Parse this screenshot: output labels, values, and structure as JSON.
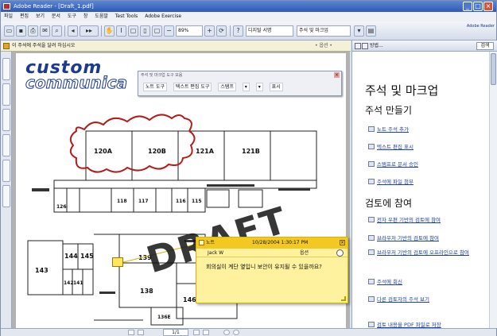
{
  "window": {
    "title": "Adobe Reader - [Draft_1.pdf]",
    "controls": [
      "_",
      "□",
      "×"
    ]
  },
  "menu": [
    "파일",
    "편집",
    "보기",
    "문서",
    "도구",
    "창",
    "도움말",
    "Test Tools",
    "Adobe Exercise"
  ],
  "toolbar": {
    "zoom": "89%",
    "select_1": "디지털 서명",
    "select_2": "주석 및 마크업",
    "logo_text": "Adobe Reader"
  },
  "docbar": {
    "text": "이 주석에 주석을 달려 하십시오",
    "right": "• 옵션 •"
  },
  "comment_toolbar": {
    "title": "주석 및 마크업 도구 모음",
    "items": [
      "노트 도구",
      "텍스트 편집 도구",
      "스탬프",
      "",
      "",
      "표시"
    ]
  },
  "logo": {
    "line1": "custom",
    "line2": "communica"
  },
  "floorplan": {
    "rooms": [
      "120A",
      "120B",
      "121A",
      "121B",
      "118",
      "117",
      "116",
      "115",
      "126",
      "144",
      "145",
      "143",
      "142",
      "141",
      "139",
      "138",
      "146A",
      "136E"
    ],
    "draft": "DRAFT"
  },
  "note": {
    "type": "노트",
    "date": "10/28/2004 1:30:17 PM",
    "author": "Jack W",
    "options": "옵션",
    "body": "회의실이 계단 옆입니 보안이 유지될 수 있을까요?"
  },
  "right_pane": {
    "header": "방법...",
    "search_btn": "검색",
    "title": "주석 및 마크업",
    "section1": "주석 만들기",
    "links1": [
      "노트 주석 추가",
      "텍스트 편집 표시",
      "스탬프로 문서 승인",
      "주석에 파일 첨부"
    ],
    "section2": "검토에 참여",
    "links2": [
      "전자 우편 기반의 검토에 참여",
      "브라우저 기반의 검토에 참여",
      "브라우저 기반의 검토에 오프라인으로 참여",
      "주석에 회신",
      "다른 검토자의 주석 보기"
    ],
    "link_bottom": "검토 내용을 PDF 파일로 저장"
  },
  "status": {
    "page": "1/1"
  }
}
